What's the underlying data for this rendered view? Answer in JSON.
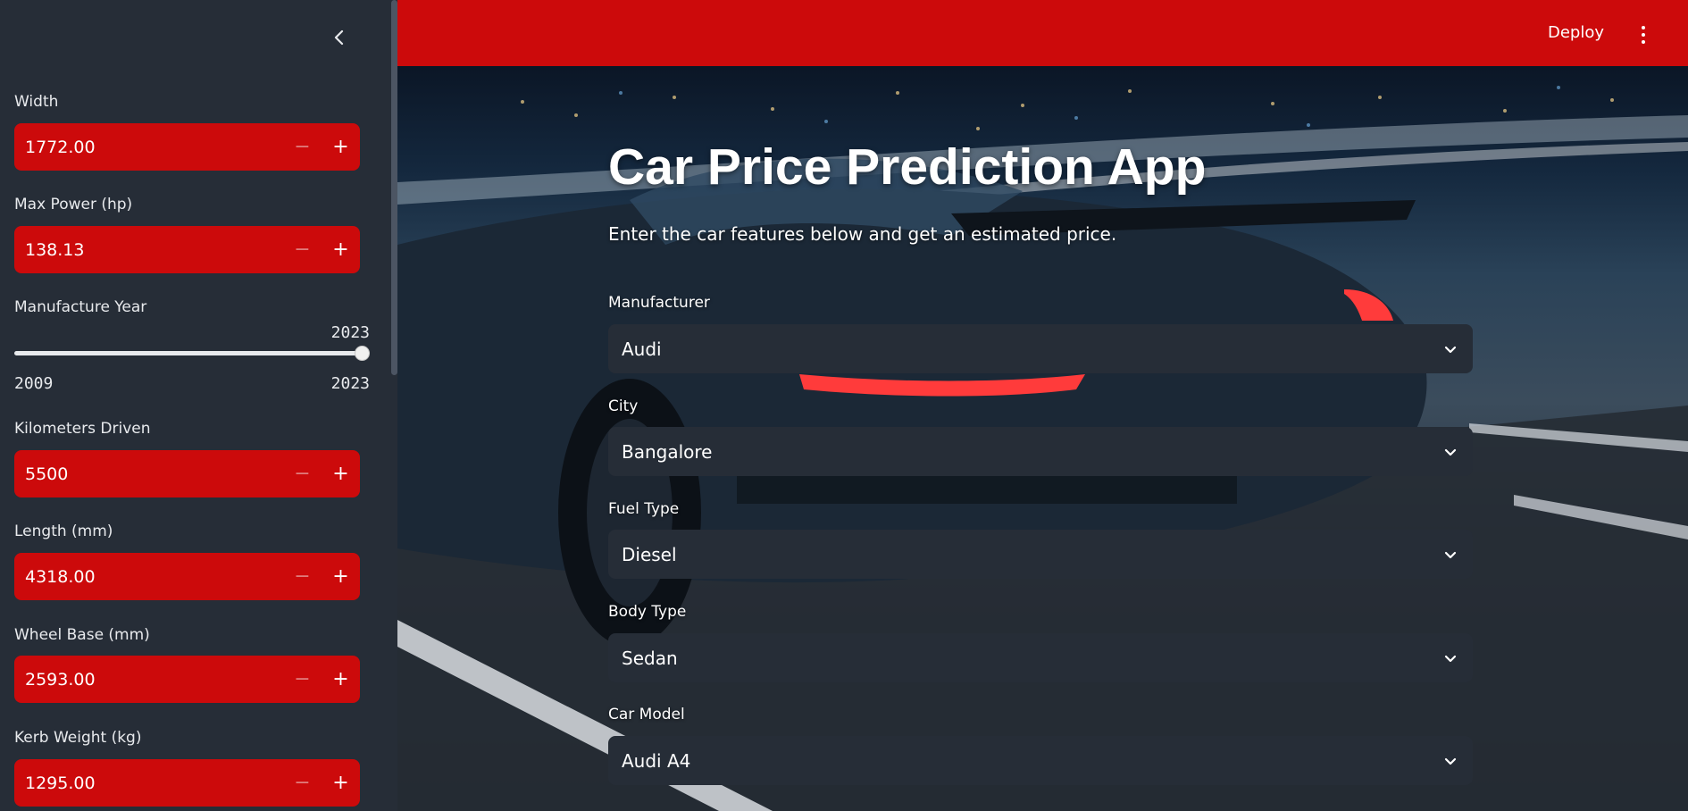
{
  "sidebar": {
    "collapse_icon": "chevron-left-icon",
    "number_inputs": [
      {
        "label": "Width",
        "value": "1772.00"
      },
      {
        "label": "Max Power (hp)",
        "value": "138.13"
      },
      {
        "label": "Kilometers Driven",
        "value": "5500"
      },
      {
        "label": "Length (mm)",
        "value": "4318.00"
      },
      {
        "label": "Wheel Base (mm)",
        "value": "2593.00"
      },
      {
        "label": "Kerb Weight (kg)",
        "value": "1295.00"
      }
    ],
    "year_slider": {
      "label": "Manufacture Year",
      "current": "2023",
      "min": "2009",
      "max": "2023",
      "fraction": 1.0
    },
    "step_minus": "−",
    "step_plus": "+"
  },
  "header": {
    "deploy_label": "Deploy",
    "menu_icon": "vertical-ellipsis-icon",
    "color": "#cc0a0b"
  },
  "main": {
    "title": "Car Price Prediction App",
    "subtitle": "Enter the car features below and get an estimated price.",
    "selects": [
      {
        "label": "Manufacturer",
        "value": "Audi"
      },
      {
        "label": "City",
        "value": "Bangalore"
      },
      {
        "label": "Fuel Type",
        "value": "Diesel"
      },
      {
        "label": "Body Type",
        "value": "Sedan"
      },
      {
        "label": "Car Model",
        "value": "Audi A4"
      }
    ]
  },
  "colors": {
    "accent": "#cc0a0b",
    "sidebar_bg": "#262d37",
    "select_bg": "#262d37"
  }
}
